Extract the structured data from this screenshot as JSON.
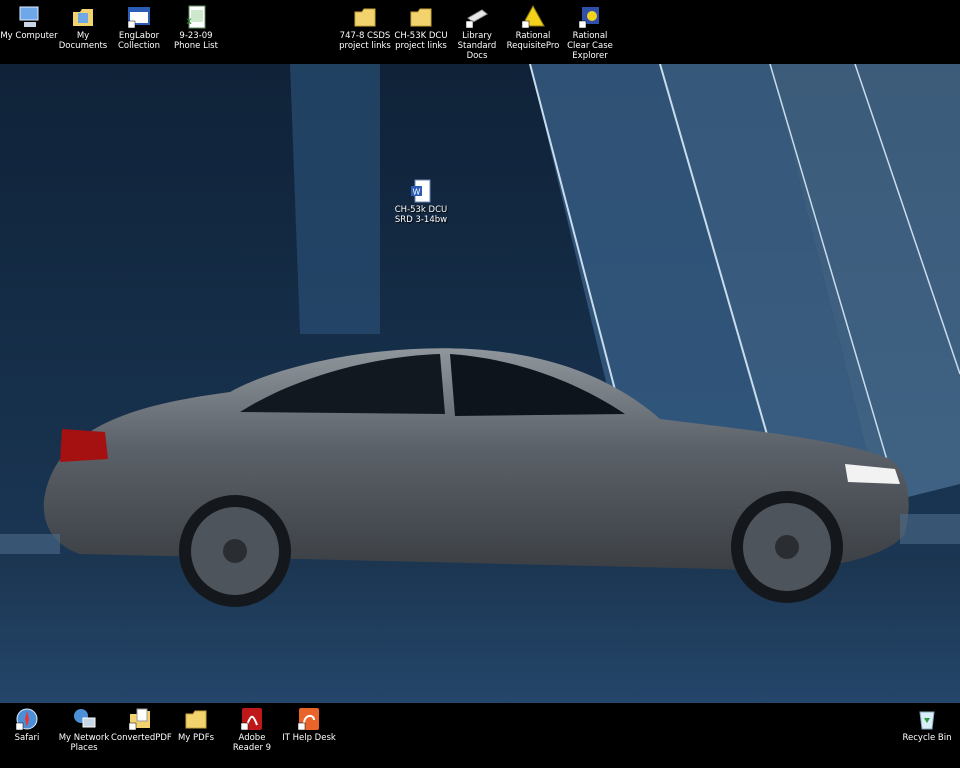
{
  "desktop": {
    "top_icons": [
      {
        "label": "My Computer",
        "icon": "computer-icon"
      },
      {
        "label": "My Documents",
        "icon": "documents-folder-icon"
      },
      {
        "label": "EngLabor Collection",
        "icon": "window-shortcut-icon"
      },
      {
        "label": "9-23-09 Phone List",
        "icon": "spreadsheet-icon"
      },
      {
        "label": "747-8 CSDS project links",
        "icon": "folder-icon"
      },
      {
        "label": "CH-53K DCU project links",
        "icon": "folder-icon"
      },
      {
        "label": "Library Standard Docs",
        "icon": "library-shortcut-icon"
      },
      {
        "label": "Rational RequisitePro",
        "icon": "requisitepro-icon"
      },
      {
        "label": "Rational Clear Case Explorer",
        "icon": "clearcase-icon"
      }
    ],
    "center_icon": {
      "label": "CH-53k DCU SRD 3-14bw",
      "icon": "word-document-icon"
    },
    "bottom_icons": [
      {
        "label": "Safari",
        "icon": "safari-icon"
      },
      {
        "label": "My Network Places",
        "icon": "network-places-icon"
      },
      {
        "label": "ConvertedPDF",
        "icon": "pdf-folder-icon"
      },
      {
        "label": "My PDFs",
        "icon": "folder-icon"
      },
      {
        "label": "Adobe Reader 9",
        "icon": "adobe-reader-icon"
      },
      {
        "label": "IT Help Desk",
        "icon": "help-desk-icon"
      },
      {
        "label": "Recycle Bin",
        "icon": "recycle-bin-icon"
      }
    ]
  }
}
